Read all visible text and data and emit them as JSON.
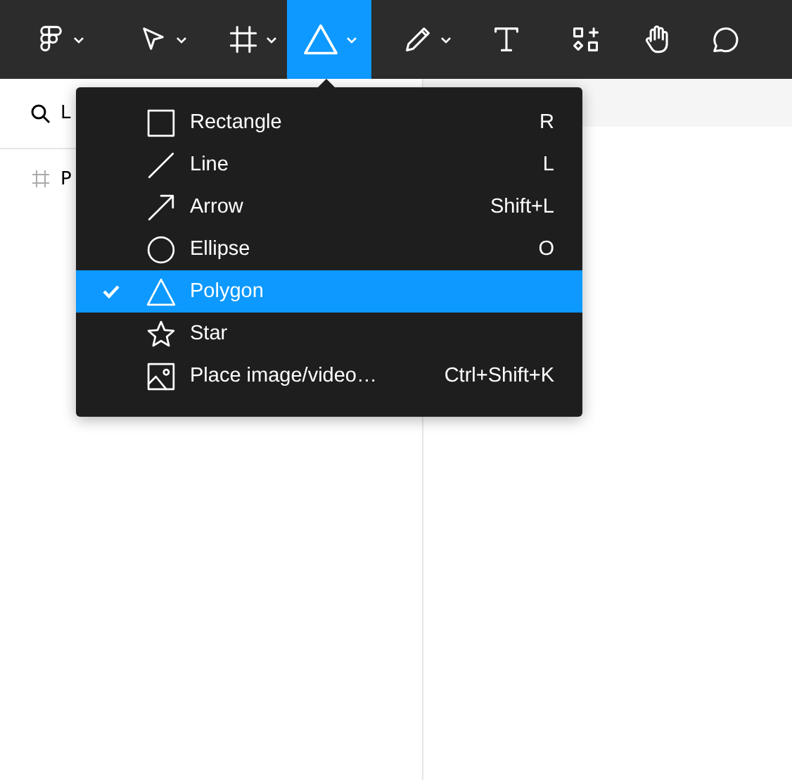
{
  "toolbar": {
    "tools": [
      {
        "kind": "logo",
        "selected": false,
        "has_menu": true
      },
      {
        "kind": "move",
        "selected": false,
        "has_menu": true
      },
      {
        "kind": "frame",
        "selected": false,
        "has_menu": true
      },
      {
        "kind": "shape",
        "selected": true,
        "has_menu": true
      },
      {
        "kind": "pen",
        "selected": false,
        "has_menu": true
      },
      {
        "kind": "text",
        "selected": false,
        "has_menu": false
      },
      {
        "kind": "components",
        "selected": false,
        "has_menu": false
      },
      {
        "kind": "hand",
        "selected": false,
        "has_menu": false
      },
      {
        "kind": "comment",
        "selected": false,
        "has_menu": false
      }
    ]
  },
  "layers_panel": {
    "search_text": "L",
    "items": [
      {
        "label": "P"
      }
    ]
  },
  "shape_menu": {
    "items": [
      {
        "kind": "rectangle",
        "label": "Rectangle",
        "shortcut": "R",
        "selected": false
      },
      {
        "kind": "line",
        "label": "Line",
        "shortcut": "L",
        "selected": false
      },
      {
        "kind": "arrow",
        "label": "Arrow",
        "shortcut": "Shift+L",
        "selected": false
      },
      {
        "kind": "ellipse",
        "label": "Ellipse",
        "shortcut": "O",
        "selected": false
      },
      {
        "kind": "polygon",
        "label": "Polygon",
        "selected": true
      },
      {
        "kind": "star",
        "label": "Star",
        "selected": false
      },
      {
        "kind": "image",
        "label": "Place image/video…",
        "shortcut": "Ctrl+Shift+K",
        "selected": false
      }
    ]
  }
}
